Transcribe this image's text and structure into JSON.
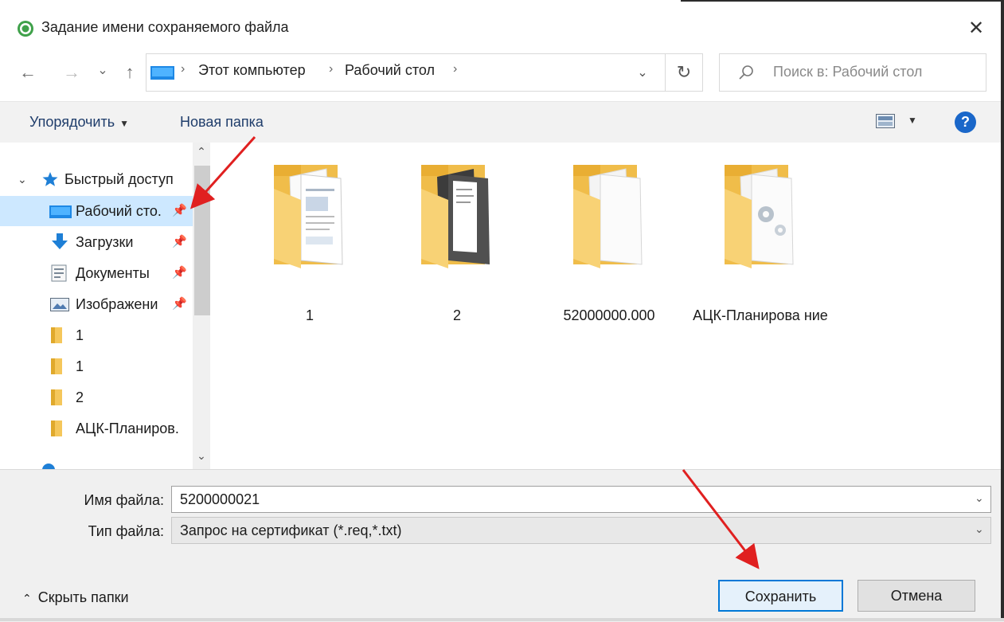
{
  "window": {
    "title": "Задание имени сохраняемого файла",
    "close_glyph": "✕"
  },
  "navigation": {
    "back_glyph": "←",
    "forward_glyph": "→",
    "recent_glyph": "⌄",
    "up_glyph": "↑",
    "breadcrumbs": [
      "Этот компьютер",
      "Рабочий стол"
    ],
    "separator": "›",
    "dropdown_glyph": "⌄",
    "refresh_glyph": "↻",
    "search_placeholder": "Поиск в: Рабочий стол"
  },
  "toolbar": {
    "organize_label": "Упорядочить",
    "organize_caret": "▼",
    "new_folder_label": "Новая папка",
    "view_caret": "▼",
    "help_glyph": "?"
  },
  "nav_pane": {
    "quick_access_label": "Быстрый доступ",
    "expand_glyph": "⌄",
    "pin_glyph": "📌",
    "items": [
      {
        "label": "Рабочий сто.",
        "icon": "desktop-icon",
        "pinned": true,
        "selected": true
      },
      {
        "label": "Загрузки",
        "icon": "downloads-icon",
        "pinned": true
      },
      {
        "label": "Документы",
        "icon": "documents-icon",
        "pinned": true
      },
      {
        "label": "Изображени",
        "icon": "pictures-icon",
        "pinned": true
      },
      {
        "label": "1",
        "icon": "folder-icon"
      },
      {
        "label": "1",
        "icon": "folder-icon"
      },
      {
        "label": "2",
        "icon": "folder-icon"
      },
      {
        "label": "АЦК-Планиров.",
        "icon": "folder-icon"
      }
    ],
    "scroll_up_glyph": "⌃",
    "scroll_down_glyph": "⌄"
  },
  "files": [
    {
      "name": "1",
      "thumb": "folder-with-documents"
    },
    {
      "name": "2",
      "thumb": "folder-with-dark-pages"
    },
    {
      "name": "52000000.000",
      "thumb": "folder-with-blank-pages"
    },
    {
      "name": "АЦК-Планирова ние",
      "thumb": "folder-with-gear-pages"
    }
  ],
  "form": {
    "filename_label": "Имя файла:",
    "filename_value": "5200000021",
    "filetype_label": "Тип файла:",
    "filetype_value": "Запрос на сертификат (*.req,*.txt)",
    "caret_glyph": "⌄"
  },
  "footer": {
    "hide_folders_glyph": "⌃",
    "hide_folders_label": "Скрыть папки",
    "save_label": "Сохранить",
    "cancel_label": "Отмена"
  },
  "colors": {
    "accent": "#0078d7",
    "selection": "#cde8ff",
    "annotation_arrow": "#e02020",
    "folder_yellow": "#f5c75b"
  }
}
